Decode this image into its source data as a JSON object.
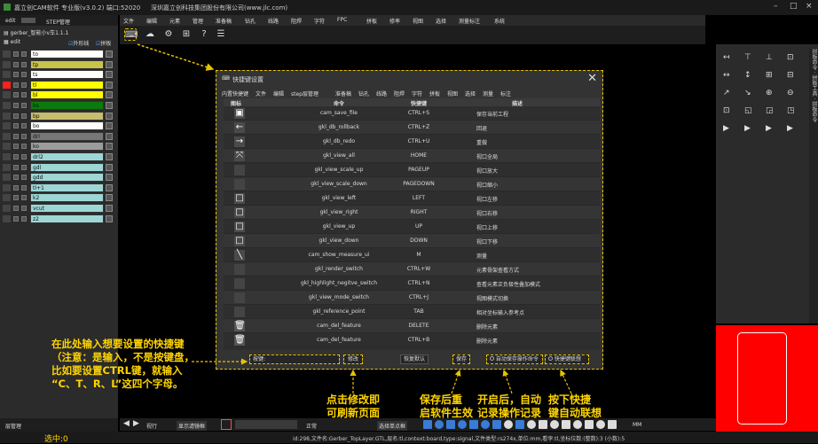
{
  "titlebar": {
    "app": "嘉立创CAM软件 专业版(v3.0.2) 端口:52020",
    "company": "深圳嘉立创科技集团股份有限公司(www.jlc.com)"
  },
  "left": {
    "tab_edit": "edit",
    "tab_step": "STEP管理",
    "job": "gerber_智能小v车1.1.1",
    "edit_label": "edit",
    "chk_outer": "外形线",
    "chk_board": "拼板",
    "layers": [
      {
        "name": "to",
        "color": "#ffffff"
      },
      {
        "name": "tp",
        "color": "#c8c44a"
      },
      {
        "name": "ts",
        "color": "#ffffff"
      },
      {
        "name": "tl",
        "color": "#ffff00"
      },
      {
        "name": "bl",
        "color": "#ffff00"
      },
      {
        "name": "bs",
        "color": "#0d7a0d"
      },
      {
        "name": "bp",
        "color": "#c8bc6e"
      },
      {
        "name": "bo",
        "color": "#ffffff"
      },
      {
        "name": "drl",
        "color": "#777777"
      },
      {
        "name": "ko",
        "color": "#9c9c9c"
      },
      {
        "name": "drl2",
        "color": "#9ed6d6"
      },
      {
        "name": "gdl",
        "color": "#9ed6d6"
      },
      {
        "name": "gdd",
        "color": "#9ed6d6"
      },
      {
        "name": "tl+1",
        "color": "#9ed6d6"
      },
      {
        "name": "k2",
        "color": "#9ed6d6"
      },
      {
        "name": "vcut",
        "color": "#9ed6d6"
      },
      {
        "name": "z2",
        "color": "#9ed6d6"
      }
    ],
    "bottom_tab": "层管理",
    "selected_label": "选中:0"
  },
  "menu": [
    "文件",
    "编辑",
    "元素",
    "管理",
    "准备稿",
    "钻孔",
    "线路",
    "阻焊",
    "字符",
    "FPC",
    "拼板",
    "修率",
    "视图",
    "选择",
    "测量标注",
    "系统"
  ],
  "dialog": {
    "title": "快捷键设置",
    "tabs": [
      "内置快捷键",
      "文件",
      "编辑",
      "step层管理",
      "准备稿",
      "钻孔",
      "线路",
      "阻焊",
      "字符",
      "拼板",
      "视图",
      "选择",
      "测量",
      "标注"
    ],
    "headers": {
      "icon": "图标",
      "command": "命令",
      "shortcut": "快捷键",
      "desc": "描述"
    },
    "rows": [
      {
        "icon": "save-icon",
        "glyph": "▣",
        "cmd": "cam_save_file",
        "key": "CTRL+S",
        "desc": "保存当前工程"
      },
      {
        "icon": "undo-icon",
        "glyph": "←",
        "cmd": "gkl_db_rollback",
        "key": "CTRL+Z",
        "desc": "回退"
      },
      {
        "icon": "redo-icon",
        "glyph": "→",
        "cmd": "gkl_db_redo",
        "key": "CTRL+U",
        "desc": "重做"
      },
      {
        "icon": "view-all-icon",
        "glyph": "⤧",
        "cmd": "gkl_view_all",
        "key": "HOME",
        "desc": "视口全局"
      },
      {
        "icon": "blank-icon",
        "glyph": "",
        "cmd": "gkl_view_scale_up",
        "key": "PAGEUP",
        "desc": "视口放大"
      },
      {
        "icon": "blank-icon",
        "glyph": "",
        "cmd": "gkl_view_scale_down",
        "key": "PAGEDOWN",
        "desc": "视口缩小"
      },
      {
        "icon": "square-icon",
        "glyph": "□",
        "cmd": "gkl_view_left",
        "key": "LEFT",
        "desc": "视口左移"
      },
      {
        "icon": "square-icon",
        "glyph": "□",
        "cmd": "gkl_view_right",
        "key": "RIGHT",
        "desc": "视口右移"
      },
      {
        "icon": "square-icon",
        "glyph": "□",
        "cmd": "gkl_view_up",
        "key": "UP",
        "desc": "视口上移"
      },
      {
        "icon": "square-icon",
        "glyph": "□",
        "cmd": "gkl_view_down",
        "key": "DOWN",
        "desc": "视口下移"
      },
      {
        "icon": "measure-icon",
        "glyph": "╲",
        "cmd": "cam_show_measure_ui",
        "key": "M",
        "desc": "测量"
      },
      {
        "icon": "blank-icon",
        "glyph": "",
        "cmd": "gkl_render_switch",
        "key": "CTRL+W",
        "desc": "元素骨架查看方式"
      },
      {
        "icon": "blank-icon",
        "glyph": "",
        "cmd": "gkl_highlight_negitve_switch",
        "key": "CTRL+N",
        "desc": "查看元素正负极性叠加模式"
      },
      {
        "icon": "blank-icon",
        "glyph": "",
        "cmd": "gkl_view_mode_switch",
        "key": "CTRL+J",
        "desc": "视图模式切换"
      },
      {
        "icon": "blank-icon",
        "glyph": "",
        "cmd": "gkl_reference_point",
        "key": "TAB",
        "desc": "相对坐标输入参考点"
      },
      {
        "icon": "delete-icon",
        "glyph": "🗑",
        "cmd": "cam_del_feature",
        "key": "DELETE",
        "desc": "删除元素"
      },
      {
        "icon": "delete-icon",
        "glyph": "🗑",
        "cmd": "cam_del_feature",
        "key": "CTRL+B",
        "desc": "删除元素"
      }
    ],
    "input_label": "按键:",
    "btn_modify": "修改",
    "btn_restore": "恢复默认",
    "btn_save": "保存",
    "chk_auto_save": "自动保存操作命令",
    "chk_shortcut": "快捷键联想"
  },
  "annotations": {
    "left_note": [
      "在此处输入想要设置的快捷键",
      "（注意：是输入，不是按键盘，",
      "比如要设置CTRL键，就输入",
      "“C、T、R、L”这四个字母。"
    ],
    "modify_note": [
      "点击修改即",
      "可刷新页面"
    ],
    "save_note": [
      "保存后重",
      "启软件生效"
    ],
    "auto_note": [
      "开启后，自动",
      "记录操作记录"
    ],
    "press_note": [
      "按下快捷",
      "键自动联想"
    ]
  },
  "bottom": {
    "zoom_label": "视行",
    "display_filter": "显示滤镜框",
    "layer_mode": "正常",
    "select_mode": "选择单点框",
    "units": "MM"
  },
  "status": "id:298,文件名:Gerber_TopLayer.GTL,层名:tl,context:board,type:signal,文件类型:rs274x,单位:mm,看孛:tl,坐标位数:(整数):3 (小数):5",
  "colors": {
    "accent": "#e8c200",
    "highlight_red": "#ff0000"
  }
}
